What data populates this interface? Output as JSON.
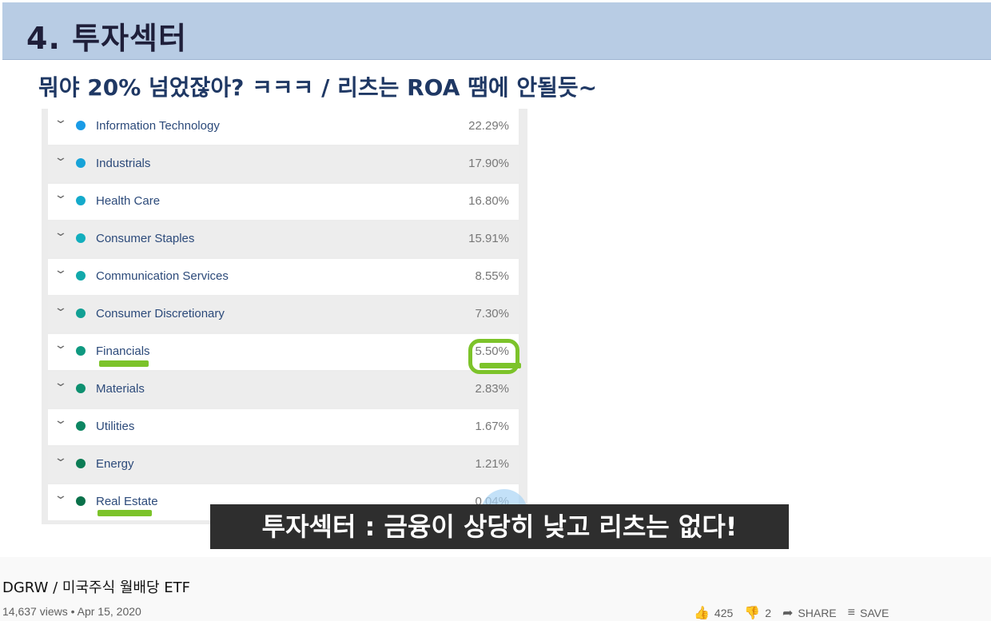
{
  "slide": {
    "title": "4. 투자섹터",
    "subtitle": "뭐야 20% 넘었잖아? ㅋㅋㅋ / 리츠는 ROA 땜에 안될듯~",
    "caption": "투자섹터 : 금융이 상당히 낮고 리츠는 없다!"
  },
  "sectors": [
    {
      "name": "Information Technology",
      "pct": "22.29%",
      "color": "#1a9be6"
    },
    {
      "name": "Industrials",
      "pct": "17.90%",
      "color": "#17a3d8"
    },
    {
      "name": "Health Care",
      "pct": "16.80%",
      "color": "#14aacb"
    },
    {
      "name": "Consumer Staples",
      "pct": "15.91%",
      "color": "#12aebd"
    },
    {
      "name": "Communication Services",
      "pct": "8.55%",
      "color": "#12a9ab"
    },
    {
      "name": "Consumer Discretionary",
      "pct": "7.30%",
      "color": "#11a094"
    },
    {
      "name": "Financials",
      "pct": "5.50%",
      "color": "#0f9980"
    },
    {
      "name": "Materials",
      "pct": "2.83%",
      "color": "#0e9070"
    },
    {
      "name": "Utilities",
      "pct": "1.67%",
      "color": "#0d8662"
    },
    {
      "name": "Energy",
      "pct": "1.21%",
      "color": "#0b7c55"
    },
    {
      "name": "Real Estate",
      "pct": "0.04%",
      "color": "#0a714a"
    }
  ],
  "video": {
    "title": "DGRW / 미국주식 월배당 ETF",
    "views": "14,637 views • Apr 15, 2020",
    "likes": "425",
    "dislikes": "2",
    "share_label": "SHARE",
    "save_label": "SAVE"
  },
  "colors": {
    "header_bg": "#b8cce4",
    "highlight": "#7cc32a",
    "caption_bg": "#2e2e2e"
  }
}
